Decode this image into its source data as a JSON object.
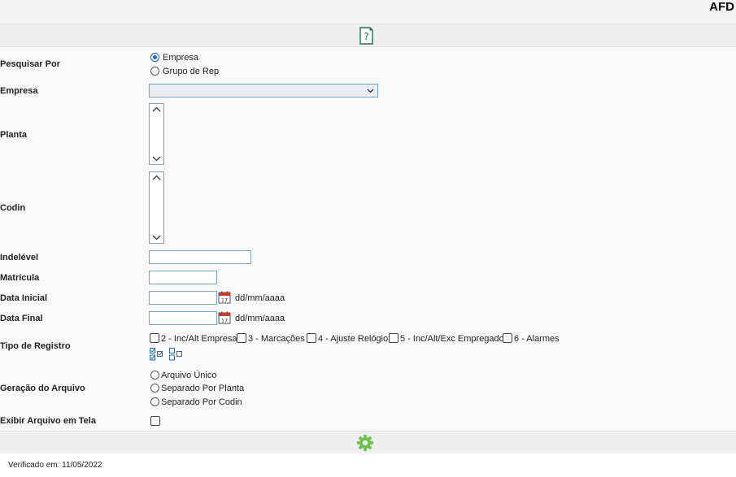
{
  "header": {
    "title": "AFD"
  },
  "form": {
    "pesquisar_por": {
      "label": "Pesquisar Por",
      "options": [
        "Empresa",
        "Grupo de Rep"
      ],
      "selected": "Empresa"
    },
    "empresa": {
      "label": "Empresa",
      "value": ""
    },
    "planta": {
      "label": "Planta"
    },
    "codin": {
      "label": "Codin"
    },
    "indelevel": {
      "label": "Indelével",
      "value": ""
    },
    "matricula": {
      "label": "Matrícula",
      "value": ""
    },
    "data_inicial": {
      "label": "Data Inicial",
      "value": "",
      "format": "dd/mm/aaaa"
    },
    "data_final": {
      "label": "Data Final",
      "value": "",
      "format": "dd/mm/aaaa"
    },
    "tipo_registro": {
      "label": "Tipo de Registro",
      "options": [
        "2 - Inc/Alt Empresa",
        "3 - Marcações",
        "4 - Ajuste Relógio",
        "5 - Inc/Alt/Exc Empregado",
        "6 - Alarmes"
      ]
    },
    "geracao_arquivo": {
      "label": "Geração do Arquivo",
      "options": [
        "Arquivo Único",
        "Separado Por Planta",
        "Separado Por Codin"
      ]
    },
    "exibir_arquivo": {
      "label": "Exibir Arquivo em Tela",
      "checked": false
    }
  },
  "icons": {
    "help": "help-icon",
    "calendar": "calendar-icon",
    "check_all": "check-all-icon",
    "uncheck_all": "uncheck-all-icon",
    "execute": "gear-icon"
  },
  "colors": {
    "accent": "#1a66c9",
    "gear": "#6cc24a"
  },
  "footer": {
    "verified": "Verificado em: 11/05/2022"
  }
}
